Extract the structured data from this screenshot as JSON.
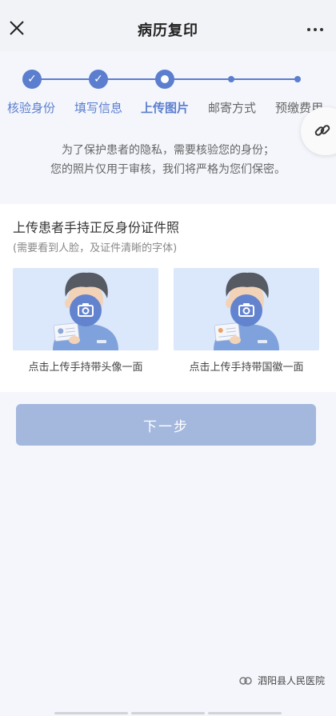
{
  "header": {
    "title": "病历复印",
    "close_icon": "close-icon",
    "more_icon": "more-dots-icon"
  },
  "steps": [
    {
      "label": "核验身份",
      "status": "done"
    },
    {
      "label": "填写信息",
      "status": "done"
    },
    {
      "label": "上传图片",
      "status": "current"
    },
    {
      "label": "邮寄方式",
      "status": "pending"
    },
    {
      "label": "预缴费用",
      "status": "pending"
    }
  ],
  "floating_link_icon": "link-icon",
  "notice": {
    "line1": "为了保护患者的隐私，需要核验您的身份；",
    "line2": "您的照片仅用于审核，我们将严格为您们保密。"
  },
  "upload": {
    "title": "上传患者手持正反身份证件照",
    "hint": "(需要看到人脸，及证件清晰的字体)",
    "cards": [
      {
        "caption": "点击上传手持带头像一面",
        "icon": "camera-icon"
      },
      {
        "caption": "点击上传手持带国徽一面",
        "icon": "camera-icon"
      }
    ]
  },
  "next_button": "下一步",
  "watermark": "泗阳县人民医院",
  "colors": {
    "accent": "#5b7ecf",
    "button_disabled": "#a4b8de",
    "card_bg": "#dbe7fa",
    "page_bg": "#f4f6fb"
  }
}
